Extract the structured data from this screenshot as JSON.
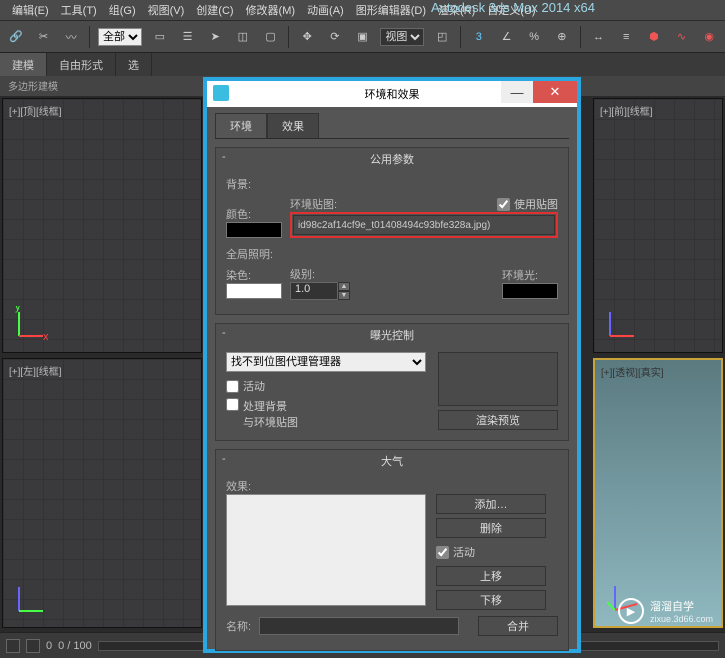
{
  "app_title": "Autodesk 3ds Max 2014 x64",
  "menus": {
    "edit": "编辑(E)",
    "tools": "工具(T)",
    "group": "组(G)",
    "views": "视图(V)",
    "create": "创建(C)",
    "modifiers": "修改器(M)",
    "animation": "动画(A)",
    "graph": "图形编辑器(D)",
    "rendering": "渲染(R)",
    "customize": "自定义(U)"
  },
  "toolbar": {
    "scope_select": "全部",
    "ref_select": "视图"
  },
  "ribbon": {
    "tab_model": "建模",
    "tab_freeform": "自由形式",
    "tab_select": "选",
    "sub_label": "多边形建模"
  },
  "viewports": {
    "tl": "[+][顶][线框]",
    "tr": "[+][前][线框]",
    "bl": "[+][左][线框]",
    "br": "[+][透视][真实]"
  },
  "timeline": {
    "frame": "0",
    "range": "0 / 100"
  },
  "dialog": {
    "title": "环境和效果",
    "tab_env": "环境",
    "tab_fx": "效果",
    "common": {
      "title": "公用参数",
      "background": "背景:",
      "color": "颜色:",
      "env_map": "环境贴图:",
      "use_map": "使用贴图",
      "map_name": "id98c2af14cf9e_t01408494c93bfe328a.jpg)",
      "global_light": "全局照明:",
      "tint": "染色:",
      "level": "级别:",
      "level_val": "1.0",
      "ambient": "环境光:"
    },
    "exposure": {
      "title": "曝光控制",
      "select": "找不到位图代理管理器",
      "active": "活动",
      "process_bg": "处理背景",
      "with_env": "与环境贴图",
      "render_preview": "渲染预览"
    },
    "atmos": {
      "title": "大气",
      "effects": "效果:",
      "add": "添加…",
      "delete": "删除",
      "active": "活动",
      "up": "上移",
      "down": "下移",
      "name": "名称:",
      "merge": "合并"
    }
  },
  "watermark": {
    "brand": "溜溜自学",
    "url": "zixue.3d66.com"
  }
}
